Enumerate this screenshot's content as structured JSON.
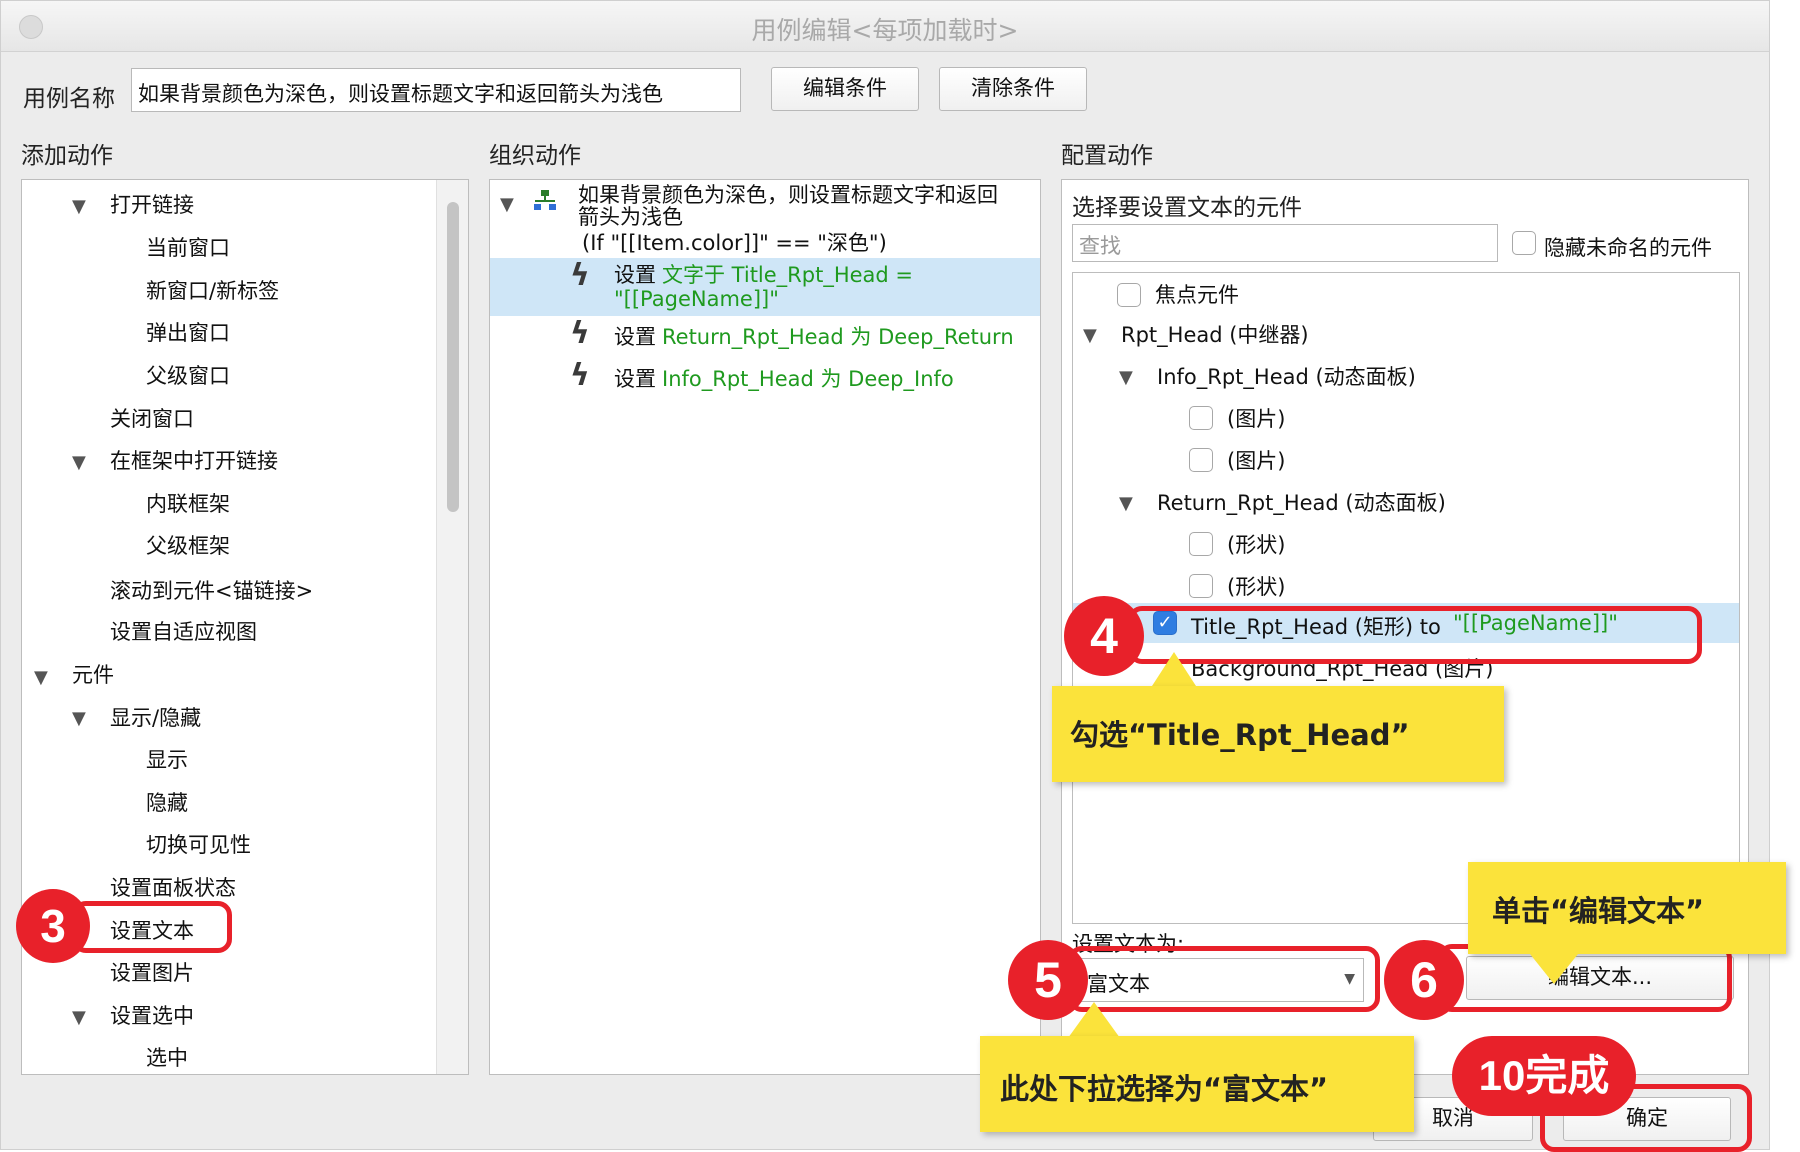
{
  "window": {
    "title": "用例编辑<每项加载时>"
  },
  "case_name": {
    "label": "用例名称",
    "value": "如果背景颜色为深色，则设置标题文字和返回箭头为浅色",
    "edit_condition": "编辑条件",
    "clear_condition": "清除条件"
  },
  "add_actions": {
    "heading": "添加动作",
    "items": [
      "打开链接",
      "当前窗口",
      "新窗口/新标签",
      "弹出窗口",
      "父级窗口",
      "关闭窗口",
      "在框架中打开链接",
      "内联框架",
      "父级框架",
      "滚动到元件<锚链接>",
      "设置自适应视图",
      "元件",
      "显示/隐藏",
      "显示",
      "隐藏",
      "切换可见性",
      "设置面板状态",
      "设置文本",
      "设置图片",
      "设置选中",
      "选中"
    ]
  },
  "organize_actions": {
    "heading": "组织动作",
    "case_line1": "如果背景颜色为深色，则设置标题文字和返回",
    "case_line2": "箭头为浅色",
    "case_condition": "(If \"[[Item.color]]\" == \"深色\")",
    "actions": [
      {
        "verb": "设置",
        "detail1": "文字于 Title_Rpt_Head =",
        "detail2": "\"[[PageName]]\""
      },
      {
        "verb": "设置",
        "detail1": "Return_Rpt_Head 为 Deep_Return"
      },
      {
        "verb": "设置",
        "detail1": "Info_Rpt_Head 为 Deep_Info"
      }
    ]
  },
  "config_actions": {
    "heading": "配置动作",
    "select_label": "选择要设置文本的元件",
    "search_placeholder": "查找",
    "hide_unnamed": "隐藏未命名的元件",
    "tree": [
      "焦点元件",
      "Rpt_Head (中继器)",
      "Info_Rpt_Head (动态面板)",
      "(图片)",
      "(图片)",
      "Return_Rpt_Head (动态面板)",
      "(形状)",
      "(形状)",
      "Title_Rpt_Head (矩形) to",
      "Background_Rpt_Head (图片)"
    ],
    "selected_suffix": "\"[[PageName]]\"",
    "set_text_label": "设置文本为:",
    "set_text_value": "富文本",
    "edit_text_button": "编辑文本..."
  },
  "footer": {
    "cancel": "取消",
    "ok": "确定"
  },
  "annotations": {
    "b3": "3",
    "b4": "4",
    "b5": "5",
    "b6": "6",
    "b10": "10完成",
    "note4": "勾选“Title_Rpt_Head”",
    "note5": "此处下拉选择为“富文本”",
    "note6": "单击“编辑文本”"
  },
  "colors": {
    "annotation_red": "#e8212a",
    "note_yellow": "#fbe33b",
    "link_green": "#1f9a1f",
    "selection_blue": "#cfe6f7"
  }
}
